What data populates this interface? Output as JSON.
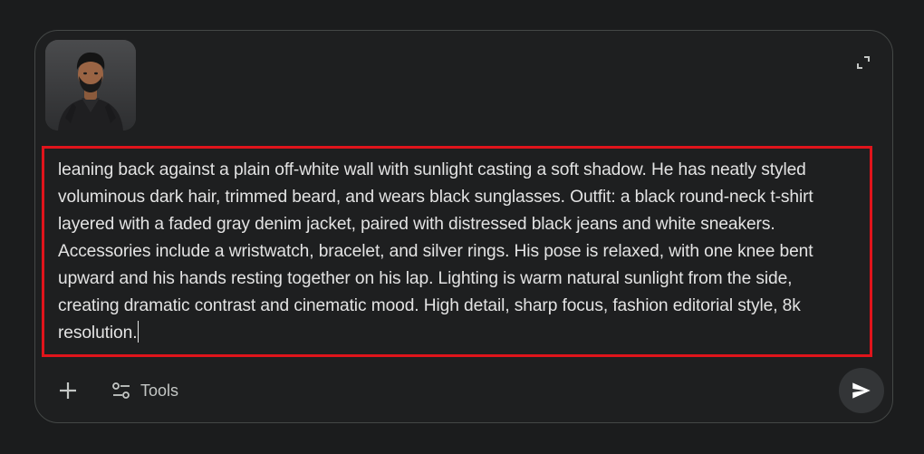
{
  "attachment": {
    "alt": "Uploaded photo of a man in a dark shirt"
  },
  "prompt": {
    "text": "leaning back against a plain off-white wall with sunlight casting a soft shadow. He has neatly styled voluminous dark hair, trimmed beard, and wears black sunglasses. Outfit: a black round-neck t-shirt layered with a faded gray denim jacket, paired with distressed black jeans and white sneakers. Accessories include a wristwatch, bracelet, and silver rings. His pose is relaxed, with one knee bent upward and his hands resting together on his lap. Lighting is warm natural sunlight from the side, creating dramatic contrast and cinematic mood. High detail, sharp focus, fashion editorial style, 8k resolution."
  },
  "toolbar": {
    "tools_label": "Tools"
  },
  "icons": {
    "expand": "expand-icon",
    "add": "plus-icon",
    "tools": "tools-sliders-icon",
    "send": "send-icon"
  },
  "colors": {
    "background": "#1b1c1d",
    "surface": "#1e1f20",
    "border": "#444746",
    "highlight": "#e0141b",
    "text": "#e3e3e3",
    "muted": "#c4c7c5",
    "send_bg": "#333537"
  }
}
